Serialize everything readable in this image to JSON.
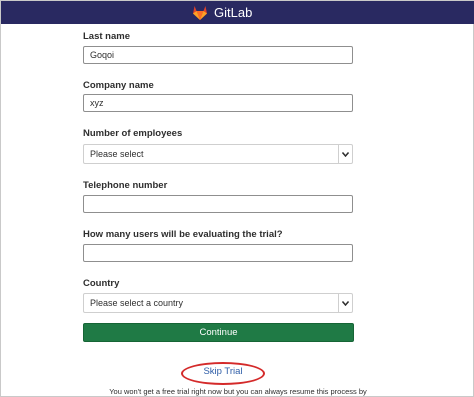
{
  "header": {
    "brand": "GitLab",
    "bg_color": "#292961",
    "logo_icon": "gitlab-tanuki-icon"
  },
  "form": {
    "last_name": {
      "label": "Last name",
      "value": "Goqoi"
    },
    "company_name": {
      "label": "Company name",
      "value": "xyz"
    },
    "employees": {
      "label": "Number of employees",
      "selected": "Please select"
    },
    "telephone": {
      "label": "Telephone number",
      "value": ""
    },
    "users": {
      "label": "How many users will be evaluating the trial?",
      "value": ""
    },
    "country": {
      "label": "Country",
      "selected": "Please select a country"
    },
    "continue_label": "Continue",
    "continue_color": "#1f7a45"
  },
  "skip": {
    "label": "Skip Trial",
    "highlight_color": "#d42a2a"
  },
  "footnote": "You won't get a free trial right now but you can always resume this process by"
}
